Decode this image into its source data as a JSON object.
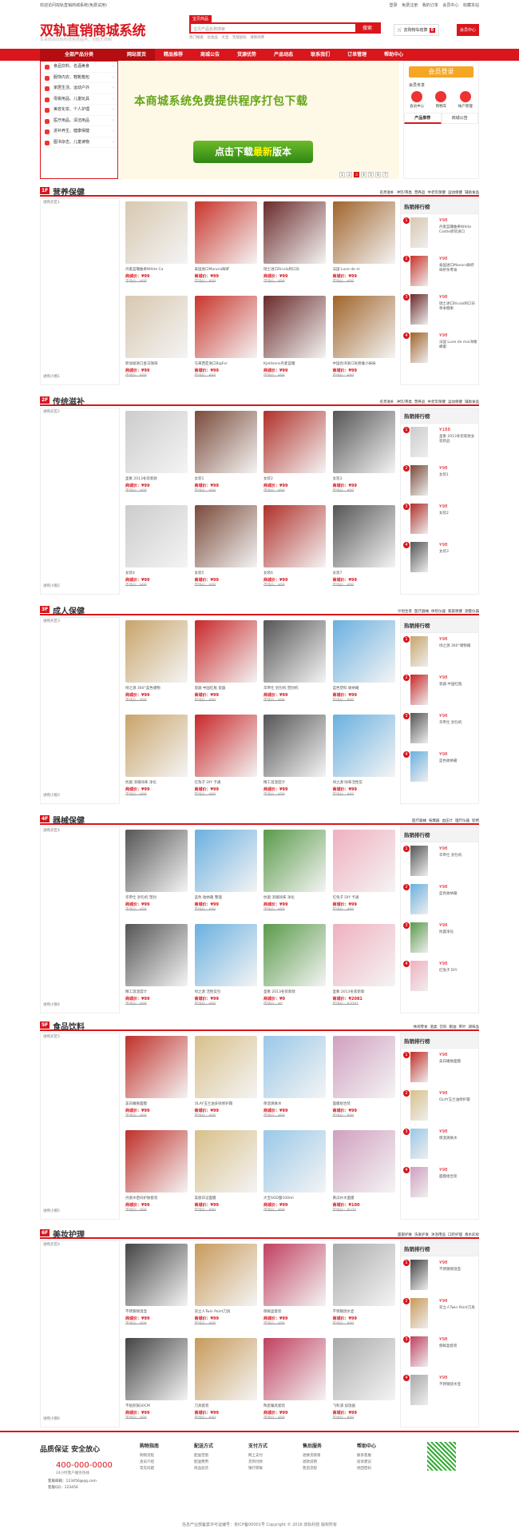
{
  "topbar": {
    "welcome": "欢迎访问双轨直销商城系统(免费试用)",
    "links": [
      "登录",
      "免费注册",
      "我的订单",
      "会员中心",
      "收藏本站"
    ]
  },
  "header": {
    "logo": "双轨直销商城系统",
    "slogan": "本系统由双轨科技免费提供，功能无限制",
    "search_tab": "宝贝商品",
    "search_placeholder": "宝贝产品名称搜索",
    "search_button": "搜索",
    "hot_words": [
      "热门搜索",
      "化妆品",
      "大宝",
      "无线鼠标",
      "清新绿茶"
    ],
    "cart_label": "去购物车结算",
    "cart_count": "0",
    "user_btn": "会员中心"
  },
  "nav": {
    "cat_title": "全部产品分类",
    "items": [
      "网站首页",
      "精品推荐",
      "商城公告",
      "货源优势",
      "产品动态",
      "联系我们",
      "订单管理",
      "帮助中心"
    ]
  },
  "categories": [
    "食品饮料、名酒美食",
    "服饰内衣、鞋靴箱包",
    "家居生活、运动户外",
    "母婴用品、儿童玩具",
    "美容化妆、个人护理",
    "医疗用品、清洁用品",
    "进补养生、健康保健",
    "图书杂志、儿童读物"
  ],
  "banner": {
    "text": "本商城系统免费提供程序打包下载",
    "btn_a": "点击下载",
    "btn_b": "最新",
    "btn_c": "版本",
    "pages": [
      "1",
      "2",
      "3",
      "4",
      "5",
      "6",
      "7"
    ],
    "active": "3"
  },
  "login": {
    "title": "会员登录",
    "member": "会员专享",
    "icons": [
      "会员中心",
      "购物车",
      "帐户管理"
    ],
    "tabs": [
      "产品推荐",
      "商城公告"
    ]
  },
  "sections": [
    {
      "no": "1F",
      "name": "营养保健",
      "ad": "进购买区1",
      "ad2": "进购小图1",
      "links": [
        "名贵滋补",
        "冲饮/茶类",
        "营养品",
        "中老年保健",
        "运动保健",
        "辅助食品"
      ],
      "products": [
        [
          "丹麦蓝罐曲奇White Ca",
          "¥99"
        ],
        [
          "泰国进口Manora鲜虾",
          "¥99"
        ],
        [
          "瑞士进口Ricola利口乐",
          "¥99"
        ],
        [
          "法国 Lune de m",
          "¥99"
        ],
        [
          "新加坡进口金马咖啡",
          "¥99"
        ],
        [
          "马来西亚进口BigFor",
          "¥99"
        ],
        [
          "Kjeldsens丹麦蓝罐",
          "¥99"
        ],
        [
          "中国台湾进口张君雅小妹妹",
          "¥99"
        ]
      ],
      "rank": [
        [
          "¥98",
          "丹麦蓝罐曲奇White Castle原装进口"
        ],
        [
          "¥98",
          "泰国进口Manora鲜虾味虾条零食"
        ],
        [
          "¥98",
          "瑞士进口Ricola利口乐草本糖果"
        ],
        [
          "¥98",
          "法国 Lune de mai洋槐蜂蜜"
        ]
      ]
    },
    {
      "no": "2F",
      "name": "传统滋补",
      "ad": "进购买区2",
      "ad2": "进购小图2",
      "links": [
        "名贵滋补",
        "冲饮/茶类",
        "营养品",
        "中老年保健",
        "运动保健",
        "辅助食品"
      ],
      "products": [
        [
          "圣象 2013冬装新款",
          "¥99"
        ],
        [
          "女装1",
          "¥99"
        ],
        [
          "女装2",
          "¥99"
        ],
        [
          "女装3",
          "¥99"
        ],
        [
          "女装4",
          "¥99"
        ],
        [
          "女装5",
          "¥99"
        ],
        [
          "女装6",
          "¥99"
        ],
        [
          "女装7",
          "¥99"
        ]
      ],
      "rank": [
        [
          "¥188",
          "圣象 2013冬装新款女装新品"
        ],
        [
          "¥98",
          "女装1"
        ],
        [
          "¥98",
          "女装2"
        ],
        [
          "¥98",
          "女装3"
        ]
      ]
    },
    {
      "no": "3F",
      "name": "成人保健",
      "ad": "进购买区3",
      "ad2": "进购小图3",
      "links": [
        "计划生育",
        "医疗器械",
        "体检仪器",
        "家庭保健",
        "测量仪器"
      ],
      "products": [
        [
          "绿之源 360°蓝色储物",
          "¥99"
        ],
        [
          "瓷器 中国红瓶 瓷器",
          "¥99"
        ],
        [
          "华帝仕 封包机 塑封机",
          "¥99"
        ],
        [
          "蓝色塑料 收纳箱",
          "¥99"
        ],
        [
          "抗菌 消毒除味 净化",
          "¥99"
        ],
        [
          "红兔子 DIY 卡通",
          "¥99"
        ],
        [
          "精工温湿度计",
          "¥99"
        ],
        [
          "绿之源 除味活性炭",
          "¥99"
        ]
      ],
      "rank": [
        [
          "¥98",
          "绿之源 360°储物箱"
        ],
        [
          "¥98",
          "瓷器 中国红瓶"
        ],
        [
          "¥98",
          "华帝仕 封包机"
        ],
        [
          "¥98",
          "蓝色收纳箱"
        ]
      ]
    },
    {
      "no": "4F",
      "name": "器械保健",
      "ad": "进购买区4",
      "ad2": "进购小图4",
      "links": [
        "医疗器械",
        "按摩器",
        "血压计",
        "理疗仪器",
        "轮椅"
      ],
      "products": [
        [
          "华帝仕 封包机 塑封",
          "¥99"
        ],
        [
          "蓝色 收纳箱 整理",
          "¥99"
        ],
        [
          "抗菌 消毒除味 净化",
          "¥99"
        ],
        [
          "红兔子 DIY 卡通",
          "¥99"
        ],
        [
          "精工温湿度计",
          "¥99"
        ],
        [
          "绿之源 活性炭包",
          "¥99"
        ],
        [
          "圣象 2013冬装新款",
          "¥0"
        ],
        [
          "圣象 2013冬装新款",
          "¥2081"
        ]
      ],
      "rank": [
        [
          "¥98",
          "华帝仕 封包机"
        ],
        [
          "¥98",
          "蓝色收纳箱"
        ],
        [
          "¥98",
          "抗菌净化"
        ],
        [
          "¥98",
          "红兔子 DIY"
        ]
      ]
    },
    {
      "no": "5F",
      "name": "食品饮料",
      "ad": "进购买区5",
      "ad2": "进购小图5",
      "links": [
        "休闲零食",
        "酒类",
        "饮料",
        "粮油",
        "茶叶",
        "调味品"
      ],
      "products": [
        [
          "美白嫩肤面膜",
          "¥99"
        ],
        [
          "OLAY玉兰油多效修护霜",
          "¥99"
        ],
        [
          "保湿爽肤水",
          "¥99"
        ],
        [
          "面膜组合装",
          "¥99"
        ],
        [
          "丹姿水密码护肤套装",
          "¥99"
        ],
        [
          "美丽日记面膜",
          "¥99"
        ],
        [
          "大宝SOD蜜100ml",
          "¥99"
        ],
        [
          "黄瓜补水面膜",
          "¥100"
        ]
      ],
      "rank": [
        [
          "¥98",
          "美白嫩肤面膜"
        ],
        [
          "¥98",
          "OLAY玉兰油修护霜"
        ],
        [
          "¥98",
          "保湿爽肤水"
        ],
        [
          "¥98",
          "面膜组合装"
        ]
      ]
    },
    {
      "no": "6F",
      "name": "美妆护理",
      "ad": "进购买区6",
      "ad2": "进购小图6",
      "links": [
        "面部护肤",
        "洗发护发",
        "沐浴用品",
        "口腔护理",
        "香水彩妆"
      ],
      "products": [
        [
          "不锈钢保温壶",
          "¥99"
        ],
        [
          "双立人Twin Point刀具",
          "¥99"
        ],
        [
          "保鲜盒套装",
          "¥99"
        ],
        [
          "不锈钢烧水壶",
          "¥99"
        ],
        [
          "不粘煎锅30CM",
          "¥99"
        ],
        [
          "刀具套装",
          "¥99"
        ],
        [
          "陶瓷餐具套装",
          "¥99"
        ],
        [
          "飞利浦 加湿器",
          "¥99"
        ]
      ],
      "rank": [
        [
          "¥98",
          "不锈钢保温壶"
        ],
        [
          "¥98",
          "双立人Twin Point刀具"
        ],
        [
          "¥98",
          "保鲜盒套装"
        ],
        [
          "¥98",
          "不锈钢烧水壶"
        ]
      ]
    }
  ],
  "footer": {
    "guarantee": "品质保证 安全放心",
    "phone": "400-000-0000",
    "hours": "24小时客户服务热线",
    "email": "客服邮箱：123456@qq.com",
    "qq": "客服QQ：123456",
    "cols": [
      {
        "t": "购物指南",
        "i": [
          "购物流程",
          "会员介绍",
          "常见问题"
        ]
      },
      {
        "t": "配送方式",
        "i": [
          "配送范围",
          "配送费用",
          "商品验货"
        ]
      },
      {
        "t": "支付方式",
        "i": [
          "网上支付",
          "货到付款",
          "银行转账"
        ]
      },
      {
        "t": "售后服务",
        "i": [
          "退换货政策",
          "退款说明",
          "售后流程"
        ]
      },
      {
        "t": "帮助中心",
        "i": [
          "联系客服",
          "投诉建议",
          "找回密码"
        ]
      }
    ],
    "copyright": "信息产业部备案许可证编号：京ICP备00001号   Copyright © 2016 双轨科技 版权所有"
  }
}
